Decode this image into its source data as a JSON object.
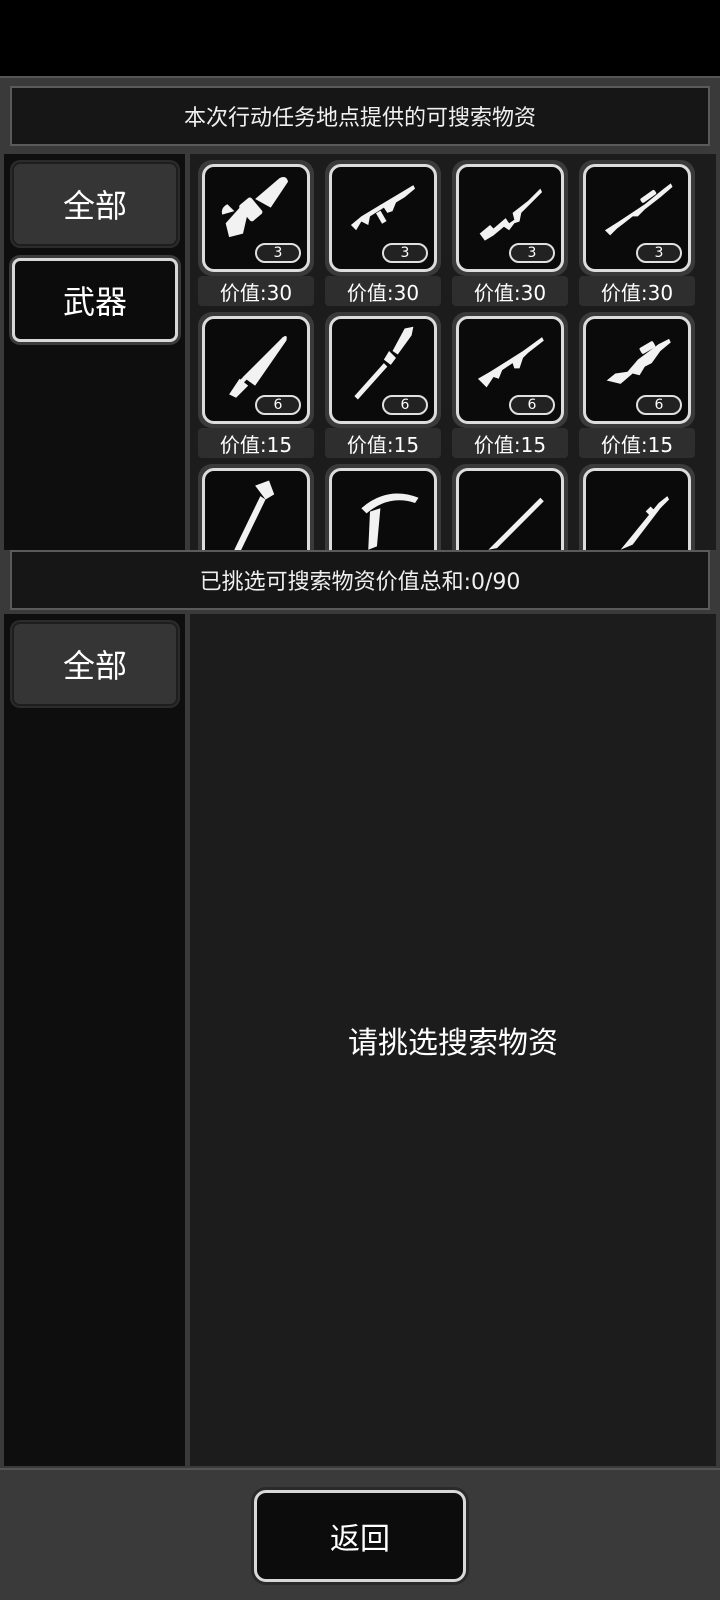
{
  "upper": {
    "header": "本次行动任务地点提供的可搜索物资",
    "tabs": [
      {
        "label": "全部",
        "active": false
      },
      {
        "label": "武器",
        "active": true
      }
    ],
    "items": [
      {
        "icon": "chainsaw-icon",
        "count": "3",
        "price": "价值:30"
      },
      {
        "icon": "assault-rifle-grenade-icon",
        "count": "3",
        "price": "价值:30"
      },
      {
        "icon": "carbine-rifle-icon",
        "count": "3",
        "price": "价值:30"
      },
      {
        "icon": "sniper-rifle-icon",
        "count": "3",
        "price": "价值:30"
      },
      {
        "icon": "combat-knife-icon",
        "count": "6",
        "price": "价值:15"
      },
      {
        "icon": "spear-icon",
        "count": "6",
        "price": "价值:15"
      },
      {
        "icon": "ak-rifle-icon",
        "count": "6",
        "price": "价值:15"
      },
      {
        "icon": "bullpup-rifle-icon",
        "count": "6",
        "price": "价值:15"
      },
      {
        "icon": "fire-axe-icon",
        "count": "",
        "price": ""
      },
      {
        "icon": "crossbow-icon",
        "count": "",
        "price": ""
      },
      {
        "icon": "bolt-rifle-icon",
        "count": "",
        "price": ""
      },
      {
        "icon": "m16-rifle-icon",
        "count": "",
        "price": ""
      }
    ]
  },
  "lower": {
    "header": "已挑选可搜索物资价值总和:0/90",
    "tabs": [
      {
        "label": "全部",
        "active": false
      }
    ],
    "empty_text": "请挑选搜索物资"
  },
  "footer": {
    "back_label": "返回"
  },
  "colors": {
    "frame": "#3a3a3a",
    "panel": "#1c1c1c",
    "sidebar": "#0e0e0e",
    "accent_border": "#d8d8d8"
  }
}
